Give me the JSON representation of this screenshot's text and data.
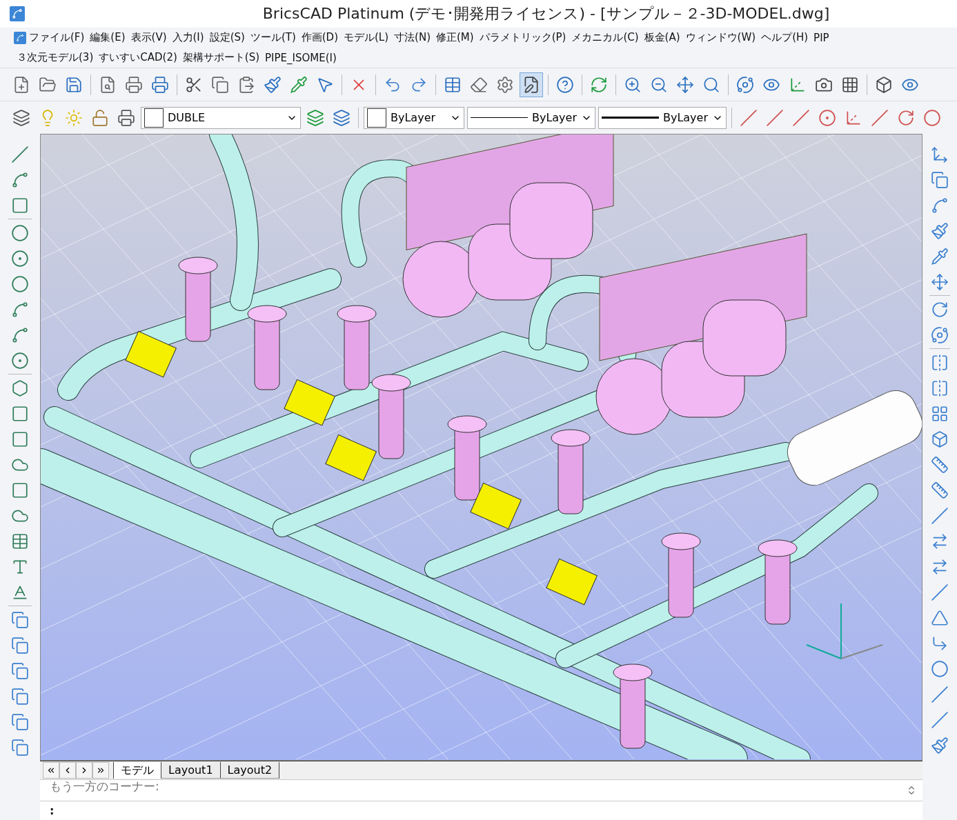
{
  "window": {
    "title": "BricsCAD Platinum (デモ･開発用ライセンス) - [サンプル－２-3D-MODEL.dwg]"
  },
  "menu_bar": {
    "main_menus": [
      "ファイル(F)",
      "編集(E)",
      "表示(V)",
      "入力(I)",
      "設定(S)",
      "ツール(T)",
      "作画(D)",
      "モデル(L)",
      "寸法(N)",
      "修正(M)",
      "パラメトリック(P)",
      "メカニカル(C)",
      "板金(A)",
      "ウィンドウ(W)",
      "ヘルプ(H)",
      "PIP"
    ],
    "addon_menus": [
      "３次元モデル(3)",
      "すいすいCAD(2)",
      "架構サポート(S)",
      "PIPE_ISOME(I)"
    ]
  },
  "properties_toolbar": {
    "layer": "DUBLE",
    "color_setting": "ByLayer",
    "linetype": "ByLayer",
    "lineweight": "ByLayer"
  },
  "layout_tabs": [
    {
      "label": "モデル",
      "selected": true
    },
    {
      "label": "Layout1",
      "selected": false
    },
    {
      "label": "Layout2",
      "selected": false
    }
  ],
  "command_line": {
    "history": "もう一方のコーナー:",
    "prompt": ":"
  }
}
